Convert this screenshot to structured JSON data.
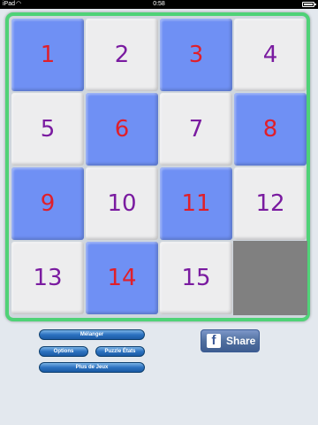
{
  "status_bar": {
    "carrier": "iPad",
    "wifi_icon": "wifi-icon",
    "time": "0:58",
    "battery_icon": "battery-icon"
  },
  "board": {
    "tiles": [
      {
        "label": "1",
        "color": "blue"
      },
      {
        "label": "2",
        "color": "light"
      },
      {
        "label": "3",
        "color": "blue"
      },
      {
        "label": "4",
        "color": "light"
      },
      {
        "label": "5",
        "color": "light"
      },
      {
        "label": "6",
        "color": "blue"
      },
      {
        "label": "7",
        "color": "light"
      },
      {
        "label": "8",
        "color": "blue"
      },
      {
        "label": "9",
        "color": "blue"
      },
      {
        "label": "10",
        "color": "light"
      },
      {
        "label": "11",
        "color": "blue"
      },
      {
        "label": "12",
        "color": "light"
      },
      {
        "label": "13",
        "color": "light"
      },
      {
        "label": "14",
        "color": "blue"
      },
      {
        "label": "15",
        "color": "light"
      }
    ],
    "colors": {
      "frame": "#4fd277",
      "blue_tile": "#6f90f4",
      "light_tile": "#ededee",
      "red_number": "#e01f2a",
      "purple_number": "#7a1ba0",
      "empty_slot": "#808080"
    }
  },
  "controls": {
    "shuffle_label": "Mélanger",
    "options_label": "Options",
    "puzzle_states_label": "Puzzle États",
    "more_games_label": "Plus de Jeux"
  },
  "share": {
    "label": "Share",
    "icon": "facebook-icon",
    "icon_glyph": "f"
  }
}
